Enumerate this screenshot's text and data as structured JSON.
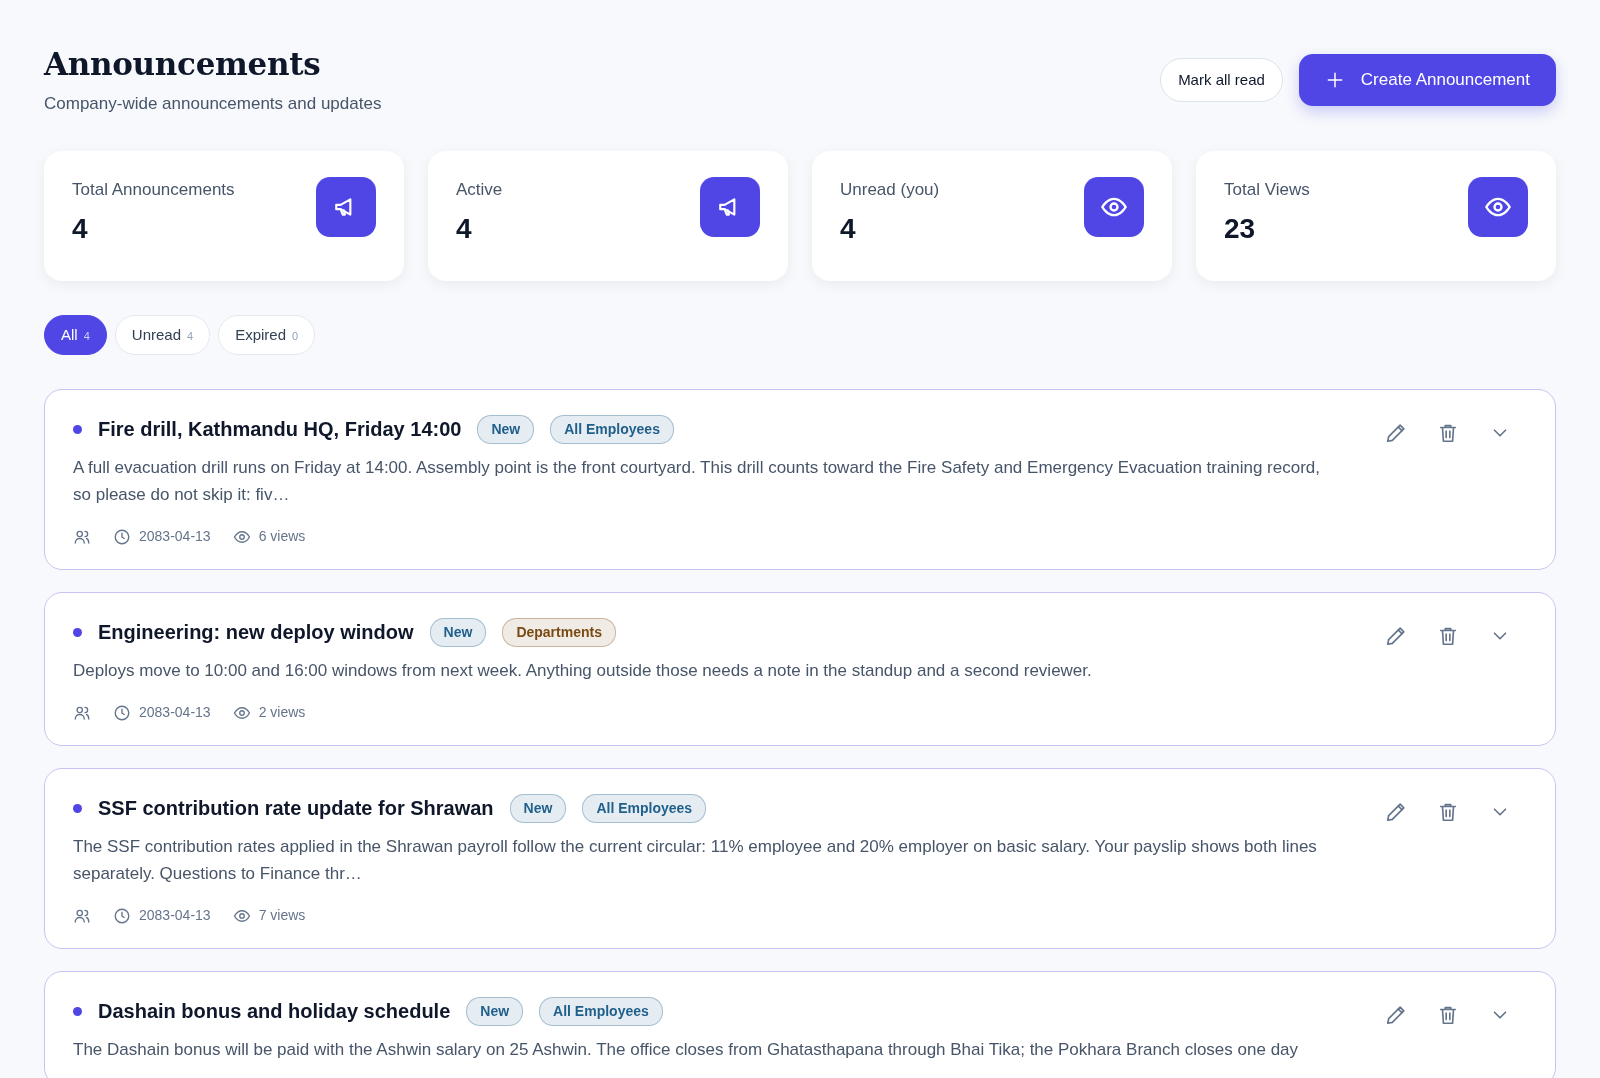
{
  "header": {
    "title": "Announcements",
    "subtitle": "Company-wide announcements and updates",
    "actions": [
      {
        "kind": "outline",
        "label": "Mark all read"
      },
      {
        "kind": "primary",
        "label": "Create Announcement"
      }
    ]
  },
  "stats": [
    {
      "label": "Total Announcements",
      "value": "4",
      "kind": "megaphone"
    },
    {
      "label": "Active",
      "value": "4",
      "kind": "megaphone"
    },
    {
      "label": "Unread (you)",
      "value": "4",
      "kind": "eye"
    },
    {
      "label": "Total Views",
      "value": "23",
      "kind": "eye"
    }
  ],
  "filters": [
    {
      "label": "All",
      "count": "4",
      "selected": true
    },
    {
      "label": "Unread",
      "count": "4",
      "selected": false
    },
    {
      "label": "Expired",
      "count": "0",
      "selected": false
    }
  ],
  "announcements": [
    {
      "title": "Fire drill, Kathmandu HQ, Friday 14:00",
      "unread": true,
      "tags": [
        {
          "label": "New",
          "color": "#1f5f8b"
        },
        {
          "label": "All Employees",
          "color": "#1f5f8b"
        }
      ],
      "body": "A full evacuation drill runs on Friday at 14:00. Assembly point is the front courtyard. This drill counts toward the Fire Safety and Emergency Evacuation training record, so please do not skip it: fiv…",
      "date": "2083-04-13",
      "views": "6 views"
    },
    {
      "title": "Engineering: new deploy window",
      "unread": true,
      "tags": [
        {
          "label": "New",
          "color": "#1f5f8b"
        },
        {
          "label": "Departments",
          "color": "#7a4a14"
        }
      ],
      "body": "Deploys move to 10:00 and 16:00 windows from next week. Anything outside those needs a note in the standup and a second reviewer.",
      "date": "2083-04-13",
      "views": "2 views"
    },
    {
      "title": "SSF contribution rate update for Shrawan",
      "unread": true,
      "tags": [
        {
          "label": "New",
          "color": "#1f5f8b"
        },
        {
          "label": "All Employees",
          "color": "#1f5f8b"
        }
      ],
      "body": "The SSF contribution rates applied in the Shrawan payroll follow the current circular: 11% employee and 20% employer on basic salary. Your payslip shows both lines separately. Questions to Finance thr…",
      "date": "2083-04-13",
      "views": "7 views"
    },
    {
      "title": "Dashain bonus and holiday schedule",
      "unread": true,
      "tags": [
        {
          "label": "New",
          "color": "#1f5f8b"
        },
        {
          "label": "All Employees",
          "color": "#1f5f8b"
        }
      ],
      "body": "The Dashain bonus will be paid with the Ashwin salary on 25 Ashwin. The office closes from Ghatasthapana through Bhai Tika; the Pokhara Branch closes one day"
    }
  ]
}
